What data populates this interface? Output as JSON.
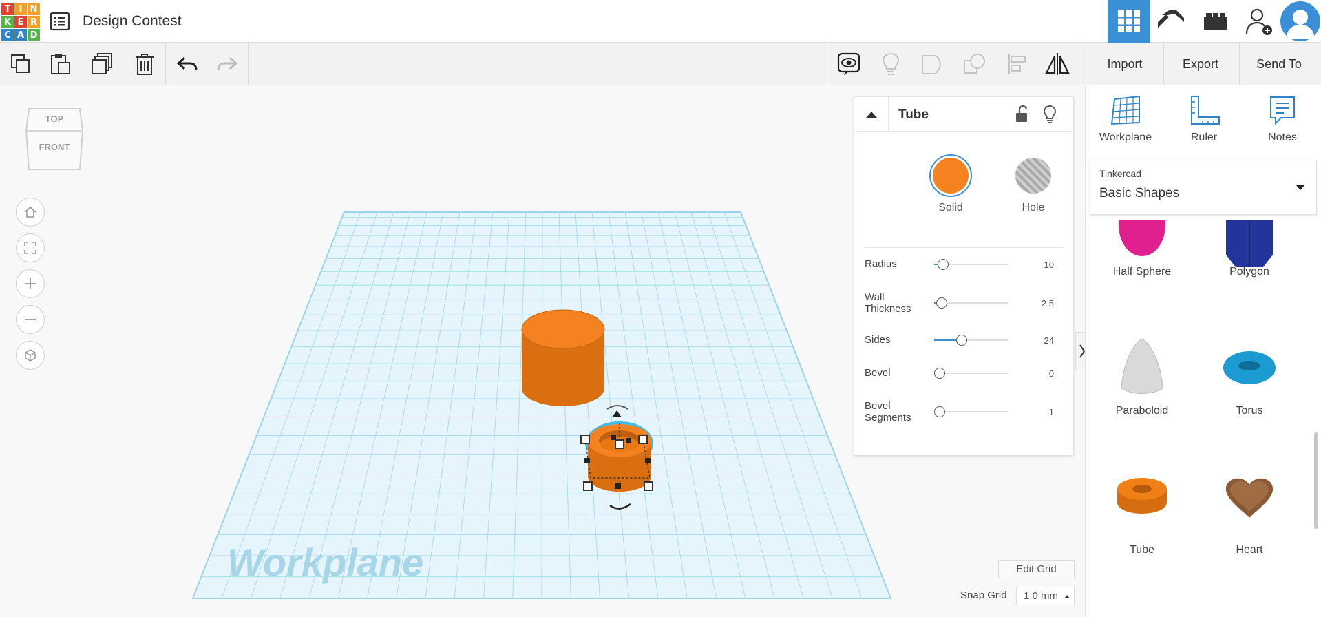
{
  "header": {
    "logo_letters": [
      "T",
      "I",
      "N",
      "K",
      "E",
      "R",
      "C",
      "A",
      "D"
    ],
    "logo_colors": [
      "#e3432c",
      "#f59f29",
      "#f59f29",
      "#55b548",
      "#e3432c",
      "#f59f29",
      "#2d85c7",
      "#2d85c7",
      "#55b548"
    ],
    "design_title": "Design Contest",
    "design_list_icon": "list-icon",
    "view_buttons": [
      "grid-3d-icon",
      "pickaxe-icon",
      "bricks-icon",
      "add-user-icon"
    ],
    "active_view_color": "#3a8fd6"
  },
  "toolbar": {
    "left_tools": [
      "copy-icon",
      "paste-icon",
      "duplicate-icon",
      "delete-icon",
      "undo-icon",
      "redo-icon"
    ],
    "right_tools": [
      "notes-visibility-icon",
      "lightbulb-icon",
      "group-icon",
      "ungroup-icon",
      "align-icon",
      "mirror-icon"
    ],
    "import_label": "Import",
    "export_label": "Export",
    "send_to_label": "Send To"
  },
  "view_cube": {
    "top_label": "TOP",
    "front_label": "FRONT"
  },
  "nav_controls": [
    "home-icon",
    "fit-view-icon",
    "zoom-in-icon",
    "zoom-out-icon",
    "ortho-view-icon"
  ],
  "workplane": {
    "watermark": "Workplane",
    "grid_color": "#bfe3f2"
  },
  "inspector": {
    "title": "Tube",
    "solid_label": "Solid",
    "hole_label": "Hole",
    "solid_color": "#f58220",
    "properties": [
      {
        "label": "Radius",
        "value": "10",
        "fraction": 0.05
      },
      {
        "label": "Wall Thickness",
        "value": "2.5",
        "fraction": 0.03
      },
      {
        "label": "Sides",
        "value": "24",
        "fraction": 0.3
      },
      {
        "label": "Bevel",
        "value": "0",
        "fraction": 0.0
      },
      {
        "label": "Bevel Segments",
        "value": "1",
        "fraction": 0.0
      }
    ]
  },
  "right_panel": {
    "tools": [
      {
        "label": "Workplane",
        "icon": "workplane-icon"
      },
      {
        "label": "Ruler",
        "icon": "ruler-icon"
      },
      {
        "label": "Notes",
        "icon": "notes-icon"
      }
    ],
    "library_category": "Tinkercad",
    "library_name": "Basic Shapes",
    "shapes": [
      {
        "label": "Half Sphere",
        "icon": "half-sphere-icon",
        "color": "#e0208f"
      },
      {
        "label": "Polygon",
        "icon": "polygon-icon",
        "color": "#23359a"
      },
      {
        "label": "Paraboloid",
        "icon": "paraboloid-icon",
        "color": "#d9d9d9"
      },
      {
        "label": "Torus",
        "icon": "torus-icon",
        "color": "#1b9bd1"
      },
      {
        "label": "Tube",
        "icon": "tube-icon",
        "color": "#f07f16"
      },
      {
        "label": "Heart",
        "icon": "heart-icon",
        "color": "#8a5a36"
      }
    ]
  },
  "grid_controls": {
    "edit_grid_label": "Edit Grid",
    "snap_grid_label": "Snap Grid",
    "snap_value": "1.0 mm"
  }
}
